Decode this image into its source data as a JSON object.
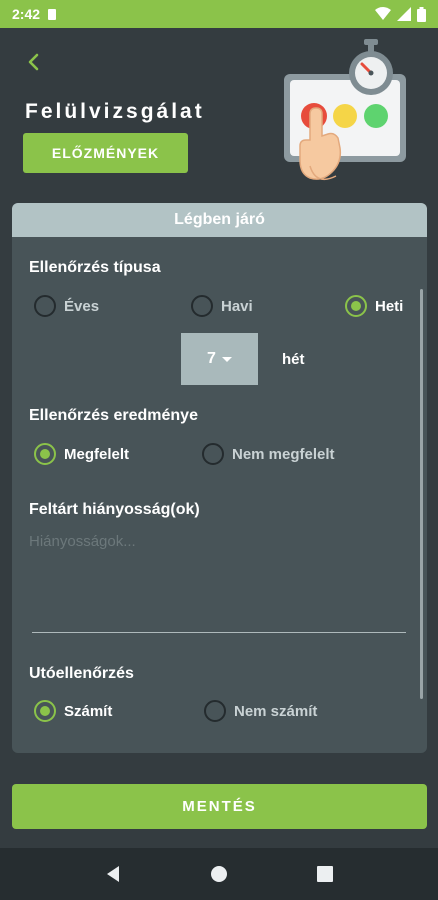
{
  "status_bar": {
    "time": "2:42"
  },
  "header": {
    "title": "Felülvizsgálat",
    "history_button": "ELŐZMÉNYEK"
  },
  "card": {
    "title": "Légben járó",
    "check_type": {
      "label": "Ellenőrzés típusa",
      "options": [
        "Éves",
        "Havi",
        "Heti"
      ],
      "selected": "Heti"
    },
    "week": {
      "value": "7",
      "unit": "hét"
    },
    "check_result": {
      "label": "Ellenőrzés eredménye",
      "options": [
        "Megfelelt",
        "Nem megfelelt"
      ],
      "selected": "Megfelelt"
    },
    "deficiencies": {
      "label": "Feltárt hiányosság(ok)",
      "placeholder": "Hiányosságok...",
      "value": ""
    },
    "follow_up": {
      "label": "Utóellenőrzés",
      "options": [
        "Számít",
        "Nem számít"
      ],
      "selected": "Számít"
    }
  },
  "save_button": "MENTÉS",
  "colors": {
    "accent": "#8bc34a",
    "background": "#343c40",
    "card": "#485458",
    "card_header": "#b2c3c5"
  }
}
